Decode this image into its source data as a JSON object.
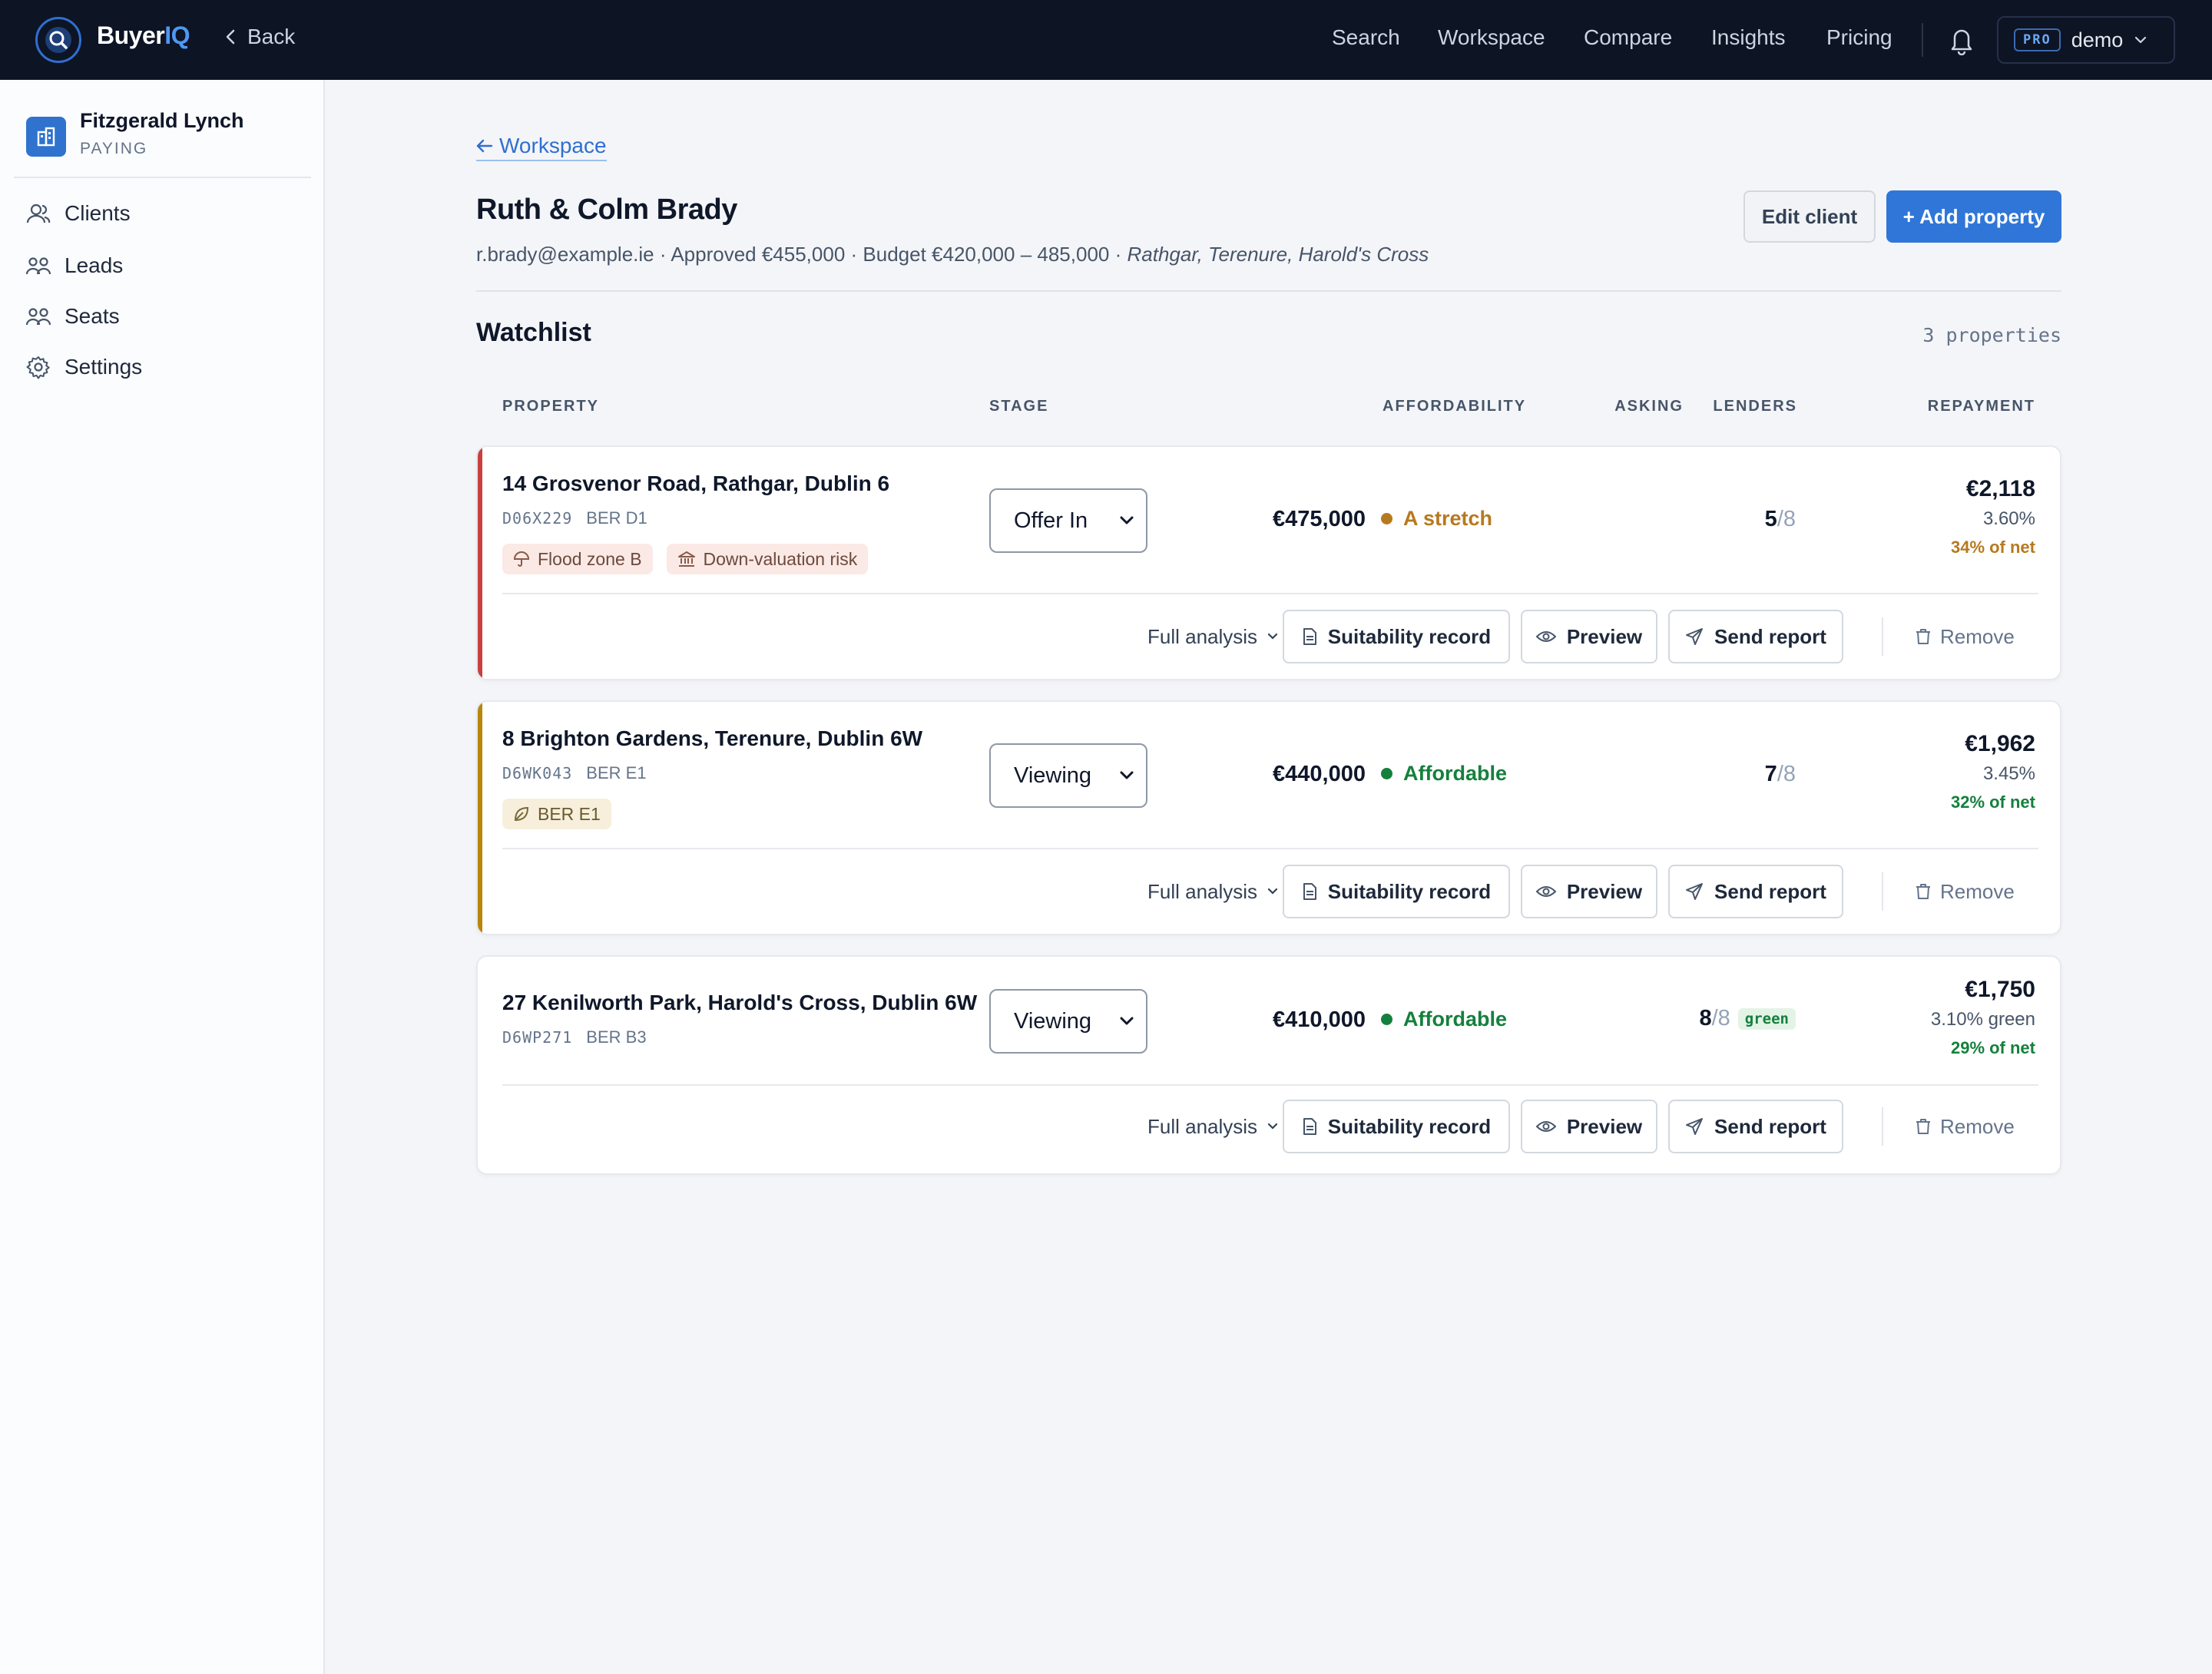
{
  "topbar": {
    "brand_prefix": "Buyer",
    "brand_suffix": "IQ",
    "back_label": "Back",
    "nav": [
      "Search",
      "Workspace",
      "Compare",
      "Insights",
      "Pricing"
    ],
    "plan_badge": "PRO",
    "user": "demo"
  },
  "sidebar": {
    "org_name": "Fitzgerald Lynch",
    "org_status": "PAYING",
    "items": [
      {
        "label": "Clients",
        "icon": "user-icon"
      },
      {
        "label": "Leads",
        "icon": "users-icon"
      },
      {
        "label": "Seats",
        "icon": "users-icon"
      },
      {
        "label": "Settings",
        "icon": "gear-icon"
      }
    ]
  },
  "page": {
    "breadcrumb": "Workspace",
    "client_name": "Ruth & Colm Brady",
    "email": "r.brady@example.ie",
    "approved": "Approved €455,000",
    "budget": "Budget €420,000 – 485,000",
    "areas": "Rathgar, Terenure, Harold's Cross",
    "edit_label": "Edit client",
    "add_label": "+ Add property"
  },
  "watchlist": {
    "title": "Watchlist",
    "count": "3 properties",
    "columns": {
      "property": "PROPERTY",
      "stage": "STAGE",
      "asking": "ASKING",
      "affordability": "AFFORDABILITY",
      "lenders": "LENDERS",
      "repayment": "REPAYMENT"
    },
    "stage_options": [
      "Offer In",
      "Viewing"
    ],
    "actions": {
      "full_analysis": "Full analysis",
      "suitability": "Suitability record",
      "preview": "Preview",
      "send": "Send report",
      "remove": "Remove"
    },
    "rows": [
      {
        "address": "14 Grosvenor Road, Rathgar, Dublin 6",
        "eircode": "D06X229",
        "ber": "BER D1",
        "tags": [
          "Flood zone B",
          "Down-valuation risk"
        ],
        "stage": "Offer In",
        "asking": "€475,000",
        "affordability": "A stretch",
        "lenders_ok": "5",
        "lenders_total": "/8",
        "green_tag": "",
        "repayment": "€2,118",
        "rate": "3.60%",
        "net": "34% of net",
        "stripe_color": "#c94040",
        "status_color": "#b7791f"
      },
      {
        "address": "8 Brighton Gardens, Terenure, Dublin 6W",
        "eircode": "D6WK043",
        "ber": "BER E1",
        "tags": [
          "BER E1"
        ],
        "stage": "Viewing",
        "asking": "€440,000",
        "affordability": "Affordable",
        "lenders_ok": "7",
        "lenders_total": "/8",
        "green_tag": "",
        "repayment": "€1,962",
        "rate": "3.45%",
        "net": "32% of net",
        "stripe_color": "#b8860b",
        "status_color": "#15803d"
      },
      {
        "address": "27 Kenilworth Park, Harold's Cross, Dublin 6W",
        "eircode": "D6WP271",
        "ber": "BER B3",
        "tags": [],
        "stage": "Viewing",
        "asking": "€410,000",
        "affordability": "Affordable",
        "lenders_ok": "8",
        "lenders_total": "/8",
        "green_tag": "green",
        "repayment": "€1,750",
        "rate": "3.10% green",
        "net": "29% of net",
        "stripe_color": "",
        "status_color": "#15803d"
      }
    ]
  }
}
